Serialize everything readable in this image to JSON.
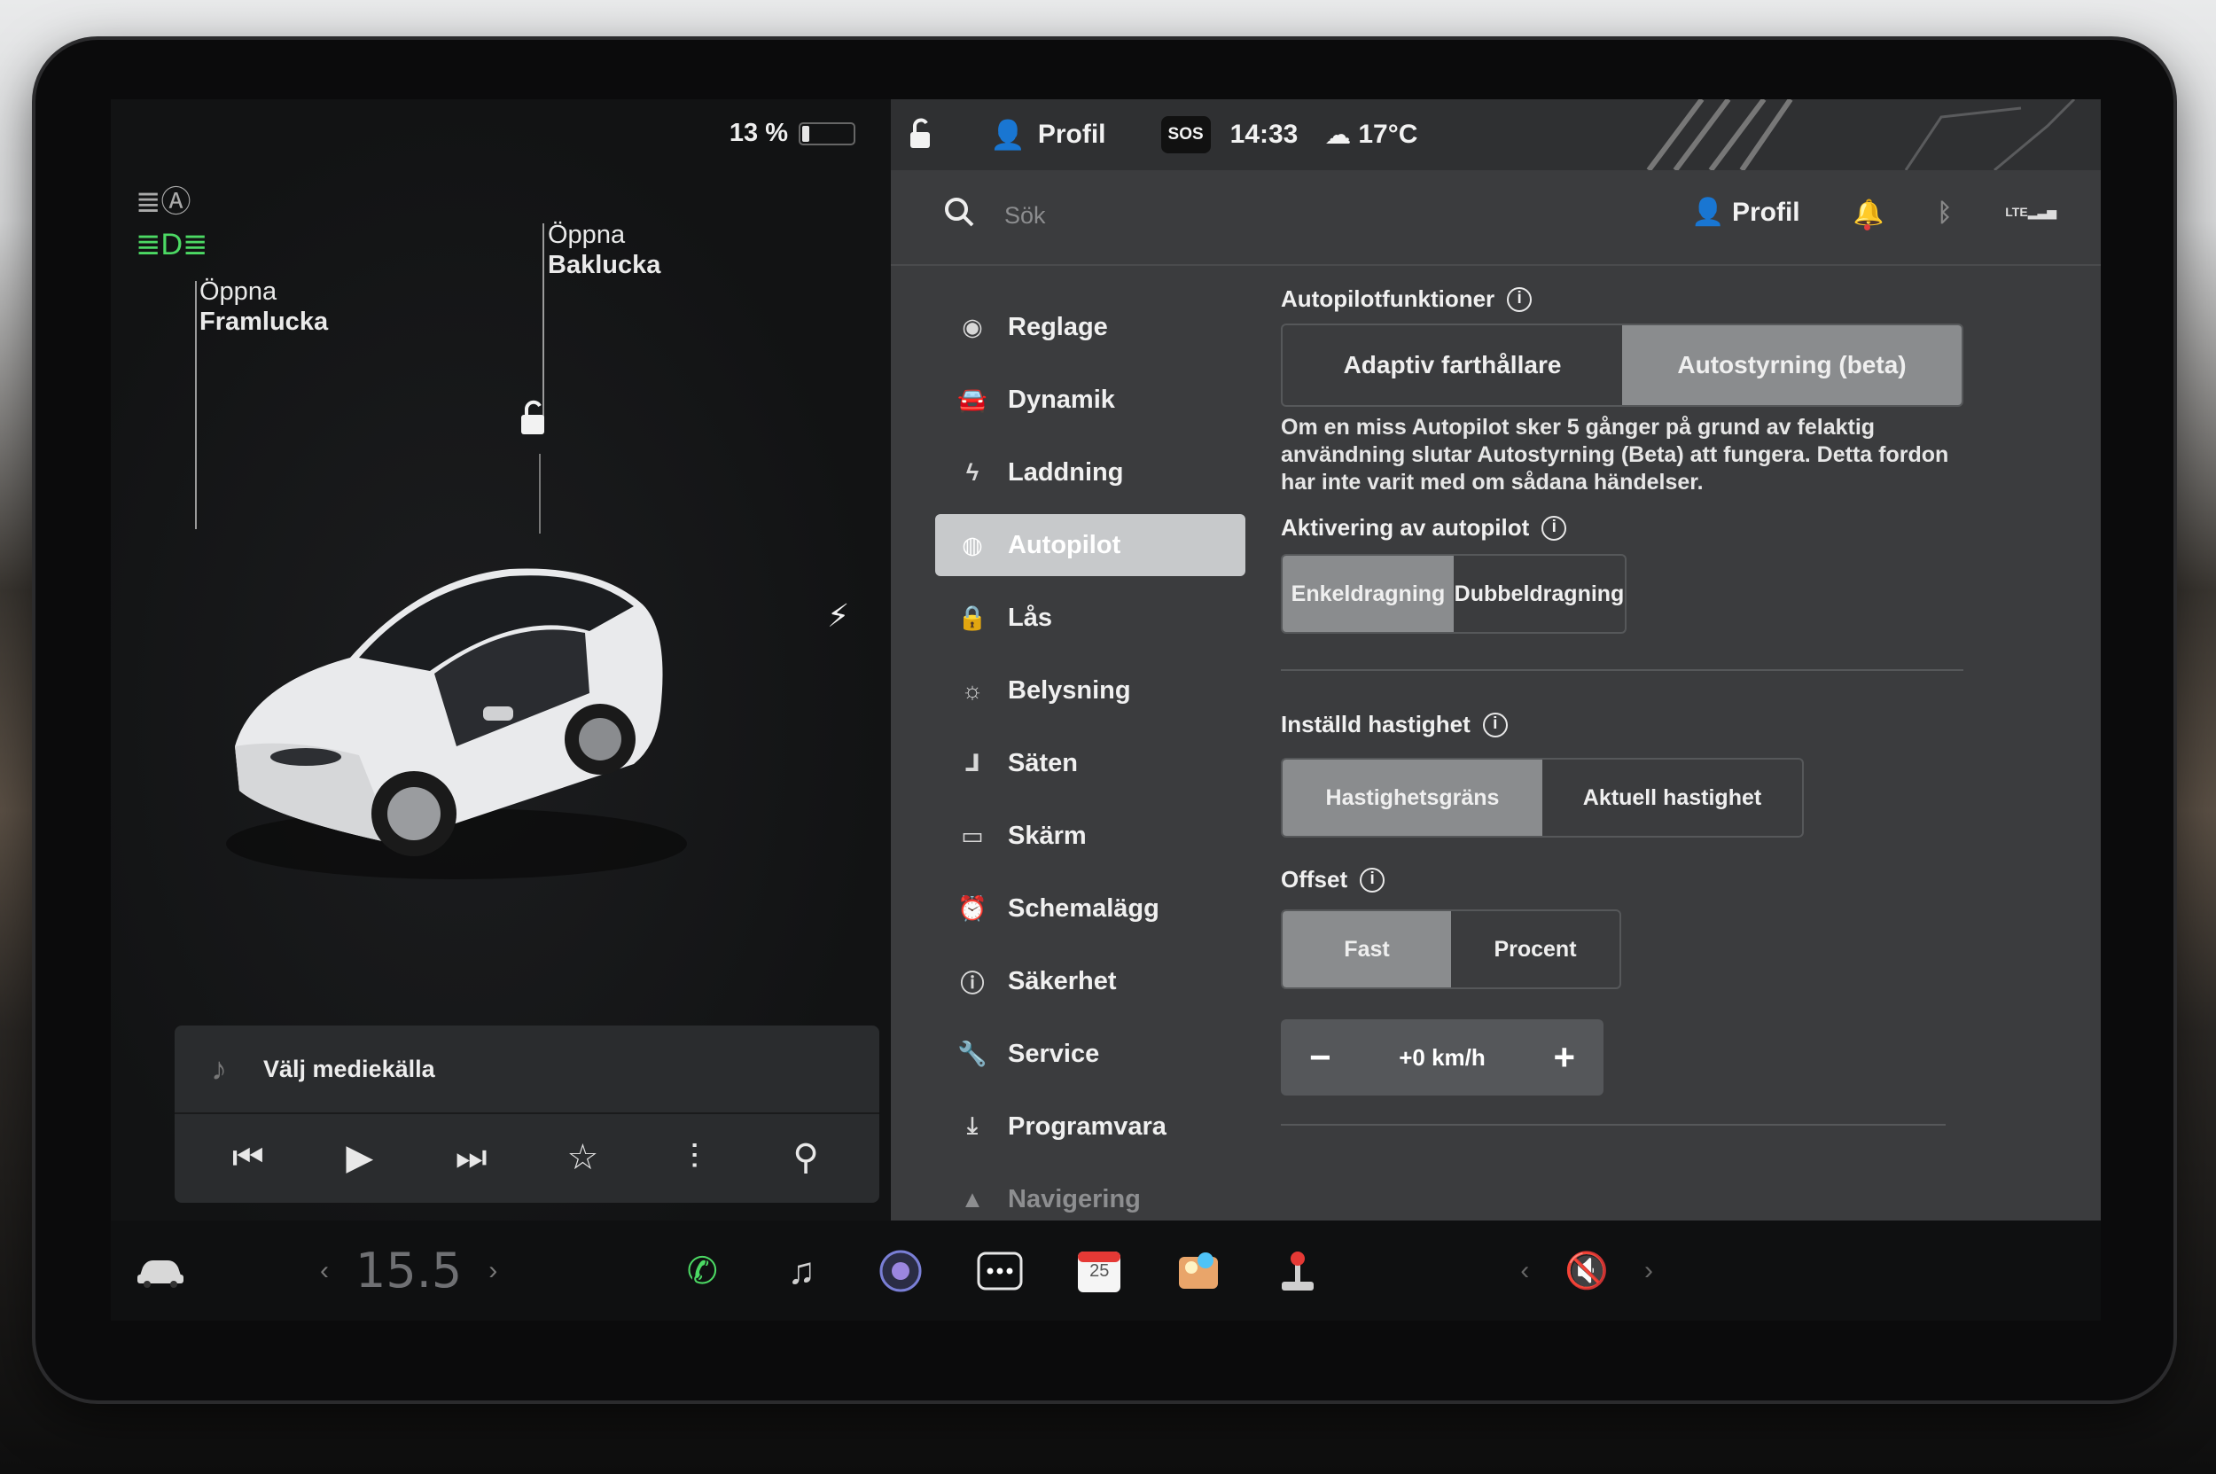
{
  "status": {
    "battery_percent": "13 %",
    "battery_level": 0.13,
    "time": "14:33",
    "temperature": "17°C",
    "sos": "SOS",
    "profile": "Profil"
  },
  "car_view": {
    "front_trunk_line1": "Öppna",
    "front_trunk_line2": "Framlucka",
    "rear_trunk_line1": "Öppna",
    "rear_trunk_line2": "Baklucka"
  },
  "media": {
    "source_label": "Välj mediekälla"
  },
  "search": {
    "placeholder": "Sök",
    "profile": "Profil"
  },
  "menu": [
    {
      "label": "Reglage",
      "icon": "toggle-icon"
    },
    {
      "label": "Dynamik",
      "icon": "car-icon"
    },
    {
      "label": "Laddning",
      "icon": "bolt-icon"
    },
    {
      "label": "Autopilot",
      "icon": "steering-wheel-icon",
      "active": true
    },
    {
      "label": "Lås",
      "icon": "lock-icon"
    },
    {
      "label": "Belysning",
      "icon": "sun-icon"
    },
    {
      "label": "Säten",
      "icon": "seat-icon"
    },
    {
      "label": "Skärm",
      "icon": "display-icon"
    },
    {
      "label": "Schemalägg",
      "icon": "alarm-icon"
    },
    {
      "label": "Säkerhet",
      "icon": "alert-icon"
    },
    {
      "label": "Service",
      "icon": "wrench-icon"
    },
    {
      "label": "Programvara",
      "icon": "download-icon"
    },
    {
      "label": "Navigering",
      "icon": "navigation-icon"
    }
  ],
  "autopilot": {
    "features_title": "Autopilotfunktioner",
    "feature_opt1": "Adaptiv farthållare",
    "feature_opt2": "Autostyrning (beta)",
    "description": "Om en miss Autopilot sker 5 gånger på grund av felaktig användning slutar Autostyrning (Beta) att fungera. Detta fordon har inte varit med om sådana händelser.",
    "activation_title": "Aktivering av autopilot",
    "activation_opt1": "Enkeldragning",
    "activation_opt2": "Dubbeldragning",
    "speed_title": "Inställd hastighet",
    "speed_opt1": "Hastighetsgräns",
    "speed_opt2": "Aktuell hastighet",
    "offset_title": "Offset",
    "offset_opt1": "Fast",
    "offset_opt2": "Procent",
    "offset_value": "+0 km/h",
    "minus": "−",
    "plus": "+"
  },
  "dock": {
    "temp_value": "15.5",
    "day": "25"
  },
  "colors": {
    "accent_green": "#4cd964",
    "active_bg": "#c7c9cb",
    "panel_bg": "#3b3c3e"
  }
}
